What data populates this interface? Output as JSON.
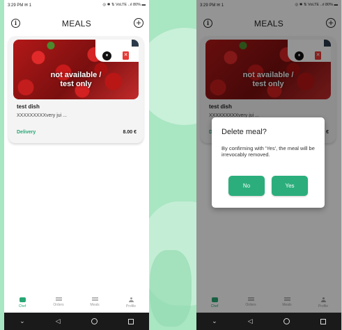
{
  "status": {
    "time": "3:29 PM",
    "left_icons": "✉ 1",
    "right_icons_left": "◎ ✱ ⇅ VoLTE ..ıl 80% ▬",
    "right_icons_right": "◎ ✱ ⇅ VoLTE ..ıl 80% ▬"
  },
  "header": {
    "title": "MEALS",
    "info_icon": "i",
    "add_icon": "+"
  },
  "meal": {
    "overlay": "not available /\ntest only",
    "name": "test dish",
    "description": "XXXXXXXXXvery jui ...",
    "delivery": "Delivery",
    "price": "8.00 €",
    "pause_icon": "⏸",
    "trash_icon": "🗑"
  },
  "nav": [
    {
      "label": "Chef",
      "icon": "chef-icon"
    },
    {
      "label": "Orders",
      "icon": "orders-icon"
    },
    {
      "label": "Meals",
      "icon": "meals-icon"
    },
    {
      "label": "Profile",
      "icon": "profile-icon"
    }
  ],
  "sysnav": {
    "back": "◁",
    "down": "⌄"
  },
  "dialog": {
    "title": "Delete meal?",
    "body": "By confirming with 'Yes', the meal will be irrevocably removed.",
    "no": "No",
    "yes": "Yes"
  },
  "colors": {
    "accent": "#2bae7c",
    "danger": "#e53935",
    "background": "#a9e6c2"
  }
}
